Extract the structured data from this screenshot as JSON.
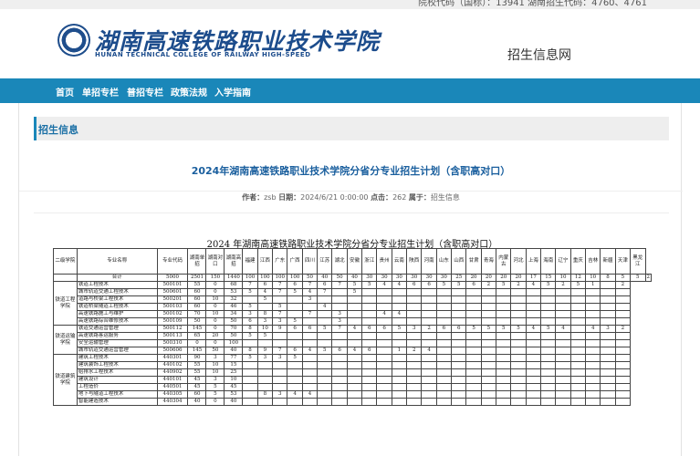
{
  "topbar": {
    "codes_text": "院校代码（国标）：13941  湖南招生代码：4760、4761"
  },
  "header": {
    "logo_cn": "湖南高速铁路职业技术学院",
    "logo_en": "HUNAN TECHNICAL COLLEGE OF RAILWAY HIGH-SPEED",
    "site_name": "招生信息网"
  },
  "nav": [
    "首页",
    "单招专栏",
    "普招专栏",
    "政策法规",
    "入学指南"
  ],
  "breadcrumb": "招生信息",
  "article": {
    "title": "2024年湖南高速铁路职业技术学院分省分专业招生计划（含职高对口）",
    "meta_author_label": "作者：",
    "meta_author": "zsb",
    "meta_date_label": "日期：",
    "meta_date": "2024/6/21 0:00:00",
    "meta_clicks_label": "点击：",
    "meta_clicks": "262",
    "meta_belongs_label": "属于：",
    "meta_belongs": "招生信息"
  },
  "sheet": {
    "title": "2024 年湖南高速铁路职业技术学院分省分专业招生计划（含职高对口）",
    "headers": [
      "二级学院",
      "专业名称",
      "专业代码",
      "湖南单招",
      "湖南对口",
      "湖南高招",
      "福建",
      "江西",
      "广东",
      "广西",
      "四川",
      "江苏",
      "湖北",
      "安徽",
      "浙江",
      "贵州",
      "云南",
      "陕西",
      "河南",
      "山东",
      "山西",
      "甘肃",
      "青海",
      "内蒙古",
      "河北",
      "上海",
      "海南",
      "辽宁",
      "重庆",
      "吉林",
      "新疆",
      "天津",
      "黑龙江"
    ],
    "total_row": [
      "合计",
      "5000",
      "2501",
      "150",
      "1440",
      "100",
      "100",
      "100",
      "100",
      "50",
      "40",
      "50",
      "40",
      "30",
      "30",
      "30",
      "30",
      "30",
      "30",
      "25",
      "20",
      "20",
      "20",
      "20",
      "17",
      "15",
      "10",
      "12",
      "10",
      "8",
      "5",
      "5",
      "2"
    ],
    "groups": [
      {
        "name": "铁道工程学院",
        "rows": [
          [
            "铁道工程技术",
            "500101",
            "55",
            "0",
            "68",
            "7",
            "6",
            "7",
            "6",
            "7",
            "6",
            "7",
            "5",
            "5",
            "4",
            "4",
            "6",
            "6",
            "5",
            "5",
            "6",
            "2",
            "5",
            "2",
            "4",
            "5",
            "2",
            "5",
            "1",
            "",
            "2"
          ],
          [
            "城市轨道交通工程技术",
            "500601",
            "60",
            "0",
            "53",
            "5",
            "4",
            "7",
            "5",
            "4",
            "7",
            "",
            "5",
            "",
            "",
            "",
            "",
            "",
            "",
            "",
            "",
            "",
            "",
            "",
            "",
            "",
            "",
            "",
            "",
            "",
            ""
          ],
          [
            "道路与桥梁工程技术",
            "500201",
            "60",
            "10",
            "32",
            "",
            "5",
            "",
            "",
            "3",
            "",
            "",
            "",
            "",
            "",
            "",
            "",
            "",
            "",
            "",
            "",
            "",
            "",
            "",
            "",
            "",
            "",
            "",
            "",
            "",
            ""
          ],
          [
            "铁道桥梁隧道工程技术",
            "500103",
            "60",
            "0",
            "46",
            "5",
            "",
            "5",
            "",
            "",
            "4",
            "",
            "",
            "",
            "",
            "",
            "",
            "",
            "",
            "",
            "",
            "",
            "",
            "",
            "",
            "",
            "",
            "",
            "",
            "",
            ""
          ],
          [
            "高速铁路施工与维护",
            "500102",
            "70",
            "10",
            "34",
            "3",
            "8",
            "7",
            "",
            "7",
            "",
            "3",
            "",
            "",
            "4",
            "4",
            "",
            "",
            "",
            "",
            "",
            "",
            "",
            "",
            "",
            "",
            "",
            "",
            "",
            "",
            ""
          ],
          [
            "高速铁路综合维修技术",
            "500109",
            "50",
            "0",
            "50",
            "6",
            "3",
            "3",
            "5",
            "",
            "",
            "3",
            "",
            "",
            "",
            "",
            "",
            "",
            "",
            "",
            "",
            "",
            "",
            "",
            "",
            "",
            "",
            "",
            "",
            "",
            ""
          ]
        ]
      },
      {
        "name": "铁道运输学院",
        "rows": [
          [
            "铁道交通运营管理",
            "500112",
            "145",
            "0",
            "70",
            "8",
            "10",
            "9",
            "6",
            "6",
            "5",
            "7",
            "4",
            "6",
            "6",
            "5",
            "3",
            "2",
            "6",
            "6",
            "5",
            "5",
            "5",
            "5",
            "4",
            "5",
            "4",
            "",
            "4",
            "3",
            "2"
          ],
          [
            "高速铁路客运服务",
            "500113",
            "65",
            "20",
            "50",
            "5",
            "5",
            "",
            "",
            "",
            "",
            "",
            "",
            "",
            "",
            "",
            "",
            "",
            "",
            "",
            "",
            "",
            "",
            "",
            "",
            "",
            "",
            "",
            "",
            "",
            ""
          ],
          [
            "安全运输管理",
            "500310",
            "0",
            "0",
            "100",
            "",
            "",
            "",
            "",
            "",
            "",
            "",
            "",
            "",
            "",
            "",
            "",
            "",
            "",
            "",
            "",
            "",
            "",
            "",
            "",
            "",
            "",
            "",
            "",
            "",
            ""
          ],
          [
            "城市轨道交通运营管理",
            "500606",
            "145",
            "50",
            "40",
            "8",
            "9",
            "7",
            "6",
            "4",
            "5",
            "6",
            "4",
            "6",
            "",
            "1",
            "2",
            "4",
            "",
            "",
            "",
            "",
            "",
            "",
            "",
            "",
            "",
            "",
            "",
            "",
            ""
          ]
        ]
      },
      {
        "name": "铁道建筑学院",
        "rows": [
          [
            "建筑工程技术",
            "440301",
            "90",
            "3",
            "77",
            "5",
            "3",
            "3",
            "5",
            "",
            "",
            "",
            "",
            "",
            "",
            "",
            "",
            "",
            "",
            "",
            "",
            "",
            "",
            "",
            "",
            "",
            "",
            "",
            "",
            "",
            ""
          ],
          [
            "建筑装饰工程技术",
            "440102",
            "55",
            "10",
            "15",
            "",
            "",
            "",
            "",
            "",
            "",
            "",
            "",
            "",
            "",
            "",
            "",
            "",
            "",
            "",
            "",
            "",
            "",
            "",
            "",
            "",
            "",
            "",
            "",
            "",
            ""
          ],
          [
            "给排水工程技术",
            "440902",
            "55",
            "10",
            "25",
            "",
            "",
            "",
            "",
            "",
            "",
            "",
            "",
            "",
            "",
            "",
            "",
            "",
            "",
            "",
            "",
            "",
            "",
            "",
            "",
            "",
            "",
            "",
            "",
            "",
            ""
          ],
          [
            "建筑设计",
            "440101",
            "45",
            "3",
            "10",
            "",
            "",
            "",
            "",
            "",
            "",
            "",
            "",
            "",
            "",
            "",
            "",
            "",
            "",
            "",
            "",
            "",
            "",
            "",
            "",
            "",
            "",
            "",
            "",
            "",
            ""
          ],
          [
            "工程造价",
            "440501",
            "45",
            "5",
            "45",
            "",
            "",
            "",
            "",
            "",
            "",
            "",
            "",
            "",
            "",
            "",
            "",
            "",
            "",
            "",
            "",
            "",
            "",
            "",
            "",
            "",
            "",
            "",
            "",
            "",
            ""
          ],
          [
            "地下与隧道工程技术",
            "440305",
            "60",
            "5",
            "53",
            "",
            "8",
            "3",
            "4",
            "4",
            "",
            "",
            "",
            "",
            "",
            "",
            "",
            "",
            "",
            "",
            "",
            "",
            "",
            "",
            "",
            "",
            "",
            "",
            "",
            "",
            ""
          ],
          [
            "智能建造技术",
            "440304",
            "40",
            "0",
            "40",
            "",
            "",
            "",
            "",
            "",
            "",
            "",
            "",
            "",
            "",
            "",
            "",
            "",
            "",
            "",
            "",
            "",
            "",
            "",
            "",
            "",
            "",
            "",
            "",
            "",
            ""
          ]
        ]
      }
    ]
  }
}
